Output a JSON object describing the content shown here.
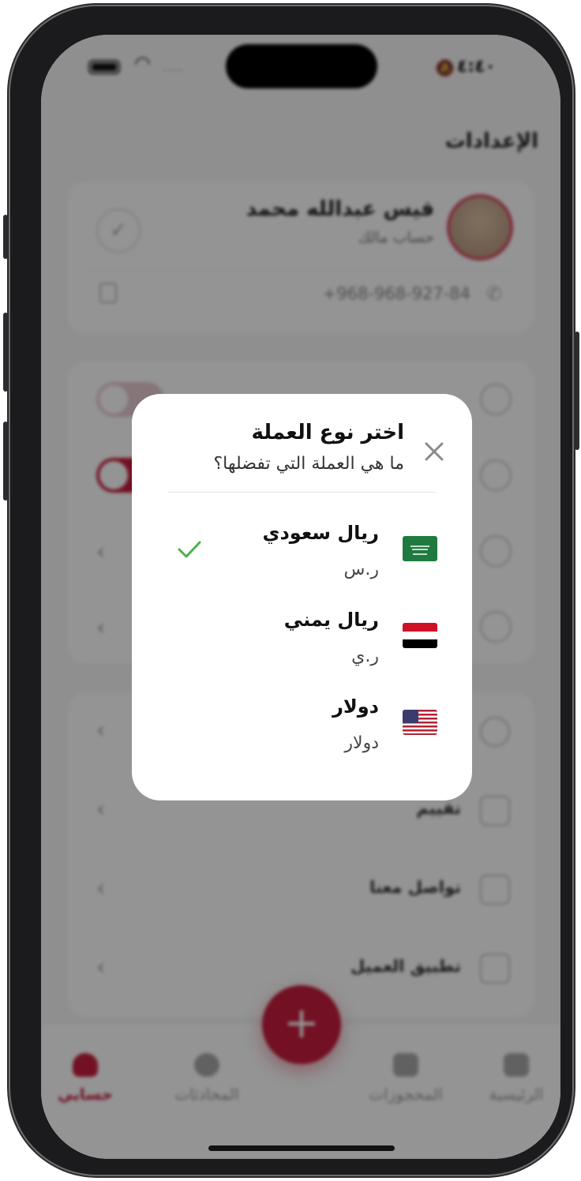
{
  "status_bar": {
    "time": "٤:٤٠",
    "carrier_dots": "...."
  },
  "page": {
    "title": "الإعدادات"
  },
  "profile": {
    "name": "قيس عبدالله محمد",
    "role": "حساب مالك",
    "phone": "968-968-927-84+"
  },
  "menu": {
    "items": [
      {
        "label": "تقييم",
        "icon": "star-icon"
      },
      {
        "label": "تواصل معنا",
        "icon": "mail-icon"
      },
      {
        "label": "تطبيق العميل",
        "icon": "swap-icon"
      }
    ]
  },
  "tabbar": {
    "fab_label": "+",
    "tabs": [
      {
        "label": "الرئيسية",
        "active": false
      },
      {
        "label": "المحجوزات",
        "active": false
      },
      {
        "label": "المحادثات",
        "active": false
      },
      {
        "label": "حسابي",
        "active": true
      }
    ]
  },
  "modal": {
    "title": "اختر نوع العملة",
    "subtitle": "ما هي العملة التي تفضلها؟",
    "currencies": [
      {
        "name": "ريال سعودي",
        "code": "ر.س",
        "flag": "saudi-flag-icon",
        "selected": true
      },
      {
        "name": "ريال يمني",
        "code": "ر.ي",
        "flag": "yemen-flag-icon",
        "selected": false
      },
      {
        "name": "دولار",
        "code": "دولار",
        "flag": "usa-flag-icon",
        "selected": false
      }
    ]
  },
  "colors": {
    "accent": "#c61d3d",
    "check": "#4caf50"
  }
}
